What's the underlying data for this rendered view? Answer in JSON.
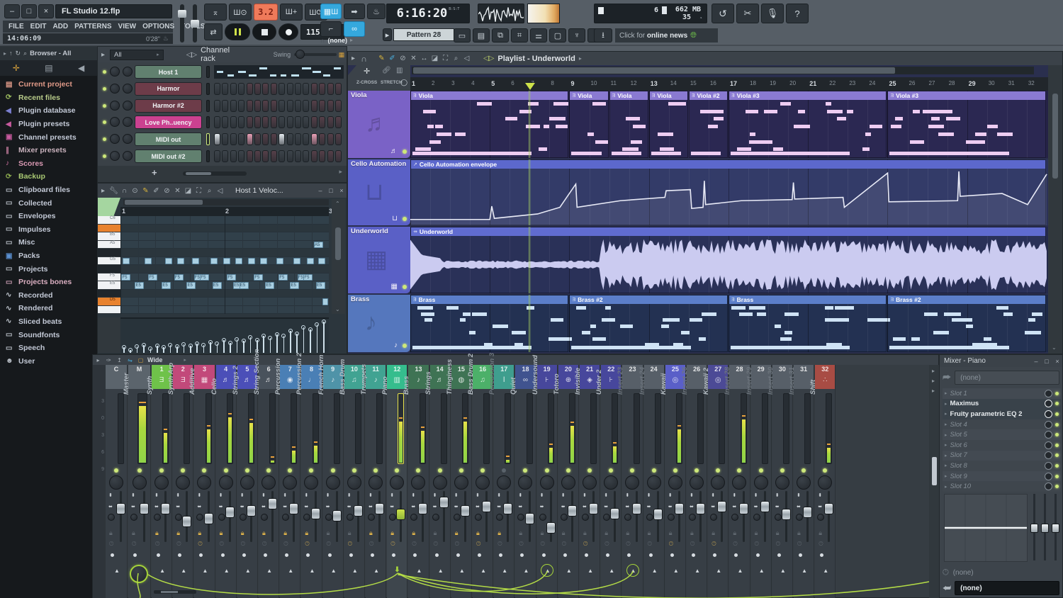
{
  "titlebar": {
    "title": "FL Studio 12.flp",
    "clock": "14:06:09",
    "song_length": "0'28\"",
    "minimize": "–",
    "maximize": "□",
    "close": "×"
  },
  "menu": {
    "items": [
      "FILE",
      "EDIT",
      "ADD",
      "PATTERNS",
      "VIEW",
      "OPTIONS",
      "TOOLS",
      "?"
    ]
  },
  "transport": {
    "bar_beat": "3.2",
    "tempo": "115.000",
    "time": "6:16:20",
    "time_unit": "B:S:T",
    "pattern": "Pattern 28",
    "pattern_plus": "+",
    "typing_target": "(none)",
    "cpu_threads": "6",
    "memory": "662 MB",
    "cpu": "35",
    "news": "Click for ",
    "news_bold": "online news"
  },
  "browser": {
    "header": "Browser - All",
    "items": [
      {
        "label": "Current project",
        "color": "#e09a88",
        "ic": "▤",
        "icc": "#e09a88"
      },
      {
        "label": "Recent files",
        "color": "#b9cc8a",
        "ic": "⟳",
        "icc": "#9fc060"
      },
      {
        "label": "Plugin database",
        "color": "#c3c9d6",
        "ic": "◀",
        "icc": "#7a7fd0"
      },
      {
        "label": "Plugin presets",
        "color": "#c3c9d6",
        "ic": "◀",
        "icc": "#c75a9e"
      },
      {
        "label": "Channel presets",
        "color": "#c3c9d6",
        "ic": "▣",
        "icc": "#c75a9e"
      },
      {
        "label": "Mixer presets",
        "color": "#c9b2bd",
        "ic": "∥",
        "icc": "#c07a9a"
      },
      {
        "label": "Scores",
        "color": "#d999b3",
        "ic": "♪",
        "icc": "#d070a0"
      },
      {
        "label": "Backup",
        "color": "#a9c973",
        "ic": "⟳",
        "icc": "#8fb050"
      },
      {
        "label": "Clipboard files",
        "color": "#c3c9d6",
        "ic": "▭",
        "icc": "#b8bec6"
      },
      {
        "label": "Collected",
        "color": "#c3c9d6",
        "ic": "▭",
        "icc": "#b8bec6"
      },
      {
        "label": "Envelopes",
        "color": "#c3c9d6",
        "ic": "▭",
        "icc": "#b8bec6"
      },
      {
        "label": "Impulses",
        "color": "#c3c9d6",
        "ic": "▭",
        "icc": "#b8bec6"
      },
      {
        "label": "Misc",
        "color": "#c3c9d6",
        "ic": "▭",
        "icc": "#b8bec6"
      },
      {
        "label": "Packs",
        "color": "#c3c9d6",
        "ic": "▣",
        "icc": "#5a8fd0"
      },
      {
        "label": "Projects",
        "color": "#c3c9d6",
        "ic": "▭",
        "icc": "#b8bec6"
      },
      {
        "label": "Projects bones",
        "color": "#d9aec0",
        "ic": "▭",
        "icc": "#c79ab0"
      },
      {
        "label": "Recorded",
        "color": "#c3c9d6",
        "ic": "∿",
        "icc": "#b8bec6"
      },
      {
        "label": "Rendered",
        "color": "#c3c9d6",
        "ic": "∿",
        "icc": "#b8bec6"
      },
      {
        "label": "Sliced beats",
        "color": "#c3c9d6",
        "ic": "∿",
        "icc": "#b8bec6"
      },
      {
        "label": "Soundfonts",
        "color": "#c3c9d6",
        "ic": "▭",
        "icc": "#b8bec6"
      },
      {
        "label": "Speech",
        "color": "#c3c9d6",
        "ic": "▭",
        "icc": "#b8bec6"
      },
      {
        "label": "User",
        "color": "#c3c9d6",
        "ic": "☻",
        "icc": "#b8bec6"
      }
    ]
  },
  "channel_rack": {
    "title": "Channel rack",
    "filter": "All",
    "swing": "Swing",
    "add": "+",
    "channels": [
      {
        "name": "Host 1",
        "color": "#61806f",
        "kind": "preview",
        "lit": []
      },
      {
        "name": "Harmor",
        "color": "#6d3c49",
        "kind": "steps",
        "lit": []
      },
      {
        "name": "Harmor #2",
        "color": "#6d3c49",
        "kind": "steps",
        "lit": []
      },
      {
        "name": "Love Ph..uency",
        "color": "#cb4190",
        "kind": "steps",
        "lit": []
      },
      {
        "name": "MIDI out",
        "color": "#61806f",
        "kind": "steps",
        "lit": [
          {
            "i": 0,
            "c": "#e3e9ee"
          },
          {
            "i": 4,
            "c": "#e79fb5"
          },
          {
            "i": 8,
            "c": "#e3e9ee"
          },
          {
            "i": 12,
            "c": "#e79fb5"
          }
        ]
      },
      {
        "name": "MIDI out #2",
        "color": "#61806f",
        "kind": "steps",
        "lit": []
      }
    ]
  },
  "piano_roll": {
    "title": "Host 1 Veloc...",
    "bars": [
      "1",
      "2",
      "3"
    ],
    "keys": [
      "C6",
      "B5",
      "A5",
      "G5",
      "F5",
      "E5",
      "D5"
    ],
    "g5": [
      0.01,
      0.115,
      0.215,
      0.275,
      0.345,
      0.435,
      0.495,
      0.555,
      0.615,
      0.675,
      0.755,
      0.835,
      0.9,
      0.955
    ],
    "f5": [
      0.005,
      0.135,
      0.26,
      0.355,
      0.385,
      0.515,
      0.645,
      0.765,
      0.855,
      0.885
    ],
    "e5": [
      0.07,
      0.2,
      0.32,
      0.445,
      0.545,
      0.575,
      0.7,
      0.82,
      0.945
    ],
    "a5": [
      0.935
    ],
    "d5": [
      0.975
    ],
    "velocities": [
      0.18,
      0.1,
      0.2,
      0.24,
      0.14,
      0.22,
      0.18,
      0.26,
      0.2,
      0.28,
      0.22,
      0.3,
      0.25,
      0.34,
      0.3,
      0.4,
      0.32,
      0.44,
      0.38,
      0.5,
      0.42,
      0.55,
      0.48,
      0.6,
      0.55,
      0.7,
      0.62,
      0.82,
      0.74,
      0.92,
      1.0
    ]
  },
  "playlist": {
    "title": "Playlist - Underworld",
    "zcross": "Z-CROSS",
    "stretch": "STRETCH",
    "playhead_bar": 7,
    "tracks": [
      {
        "name": "Viola",
        "color": "#7a62c6",
        "bg": "#2b2852",
        "bar": "#8a7ad2",
        "note": "#eecdf2",
        "icon": "violin-icon",
        "glyph": "♬",
        "clips": [
          {
            "label": "Viola",
            "start": 1,
            "len": 8
          },
          {
            "label": "Viola",
            "start": 9,
            "len": 2
          },
          {
            "label": "Viola",
            "start": 11,
            "len": 2
          },
          {
            "label": "Viola",
            "start": 13,
            "len": 2
          },
          {
            "label": "Viola #2",
            "start": 15,
            "len": 2
          },
          {
            "label": "Viola #3",
            "start": 17,
            "len": 8
          },
          {
            "label": "Viola #3",
            "start": 25,
            "len": 8
          }
        ]
      },
      {
        "name": "Cello Automation",
        "color": "#5a60c6",
        "bg": "#333b68",
        "bar": "#5c68cc",
        "note": "#f0f0fa",
        "icon": "plug-icon",
        "glyph": "⊔",
        "clips": [
          {
            "label": "Cello Automation envelope",
            "start": 1,
            "len": 32,
            "type": "automation"
          }
        ],
        "curve": [
          [
            0,
            0.08
          ],
          [
            0.125,
            0.08
          ],
          [
            0.128,
            0.32
          ],
          [
            0.132,
            0.1
          ],
          [
            0.2,
            0.18
          ],
          [
            0.235,
            0.3
          ],
          [
            0.26,
            0.72
          ],
          [
            0.262,
            0.3
          ],
          [
            0.33,
            0.42
          ],
          [
            0.4,
            0.48
          ],
          [
            0.402,
            0.6
          ],
          [
            0.44,
            0.62
          ],
          [
            0.442,
            0.28
          ],
          [
            0.46,
            0.3
          ],
          [
            0.462,
            0.78
          ],
          [
            0.464,
            0.35
          ],
          [
            0.52,
            0.42
          ],
          [
            0.6,
            0.44
          ],
          [
            0.602,
            0.75
          ],
          [
            0.604,
            0.45
          ],
          [
            0.68,
            0.48
          ],
          [
            0.682,
            0.3
          ],
          [
            0.75,
            0.92
          ],
          [
            0.752,
            0.4
          ],
          [
            0.86,
            0.42
          ],
          [
            0.862,
            0.95
          ],
          [
            0.864,
            0.5
          ],
          [
            0.93,
            0.55
          ],
          [
            0.97,
            0.35
          ],
          [
            1.0,
            0.9
          ]
        ]
      },
      {
        "name": "Underworld",
        "color": "#5a60c6",
        "bg": "#2a3158",
        "bar": "#606cd0",
        "note": "#cbcbf0",
        "icon": "sampler-icon",
        "glyph": "▦",
        "clips": [
          {
            "label": "Underworld",
            "start": 1,
            "len": 32,
            "type": "audio"
          }
        ]
      },
      {
        "name": "Brass",
        "color": "#5577bd",
        "bg": "#233152",
        "bar": "#5b7ec9",
        "note": "#cfe3f5",
        "icon": "trumpet-icon",
        "glyph": "♪",
        "clips": [
          {
            "label": "Brass",
            "start": 1,
            "len": 8
          },
          {
            "label": "Brass #2",
            "start": 9,
            "len": 8
          },
          {
            "label": "Brass",
            "start": 17,
            "len": 8
          },
          {
            "label": "Brass #2",
            "start": 25,
            "len": 8
          }
        ]
      }
    ]
  },
  "mixer": {
    "view": "Wide",
    "current_label": "C",
    "master_label": "M",
    "master_name": "Master",
    "channels": [
      {
        "num": "1",
        "name": "Synth",
        "color": "#6fc24a",
        "meter": 0.45,
        "fader": 0.3,
        "lock": true
      },
      {
        "num": "2",
        "name": "Synth Arp",
        "color": "#c2497a",
        "meter": 0,
        "fader": 0.62,
        "lock": true
      },
      {
        "num": "3",
        "name": "Additive",
        "color": "#c2497a",
        "meter": 0.5,
        "fader": 0.55,
        "lock": true
      },
      {
        "num": "4",
        "name": "Cello",
        "color": "#4b4fb8",
        "meter": 0.68,
        "fader": 0.4,
        "lock": true
      },
      {
        "num": "5",
        "name": "Strings 2",
        "color": "#4b4fb8",
        "meter": 0.6,
        "fader": 0.35,
        "lock": true
      },
      {
        "num": "6",
        "name": "String Section",
        "color": "#49525c",
        "meter": 0.03,
        "fader": 0.18,
        "lock": true
      },
      {
        "num": "7",
        "name": "Percussion",
        "color": "#4a7fb5",
        "meter": 0.18,
        "fader": 0.3,
        "lock": true
      },
      {
        "num": "8",
        "name": "Percussion 2",
        "color": "#4a7fb5",
        "meter": 0.26,
        "fader": 0.42,
        "lock": true
      },
      {
        "num": "9",
        "name": "French Horn",
        "color": "#4f93a8",
        "meter": 0,
        "fader": 0.48,
        "lock": false
      },
      {
        "num": "10",
        "name": "Bass Drum",
        "color": "#41a392",
        "meter": 0,
        "fader": 0.35,
        "lock": false
      },
      {
        "num": "11",
        "name": "Trumpets",
        "color": "#41a392",
        "meter": 0,
        "fader": 0.3,
        "lock": true
      },
      {
        "num": "12",
        "name": "Piano",
        "color": "#35bd8d",
        "meter": 0.62,
        "fader": 0.45,
        "lock": true,
        "selected": true
      },
      {
        "num": "13",
        "name": "Brass",
        "color": "#3f7354",
        "meter": 0.48,
        "fader": 0.3,
        "lock": true
      },
      {
        "num": "14",
        "name": "Strings",
        "color": "#3f7354",
        "meter": 0,
        "fader": 0.15,
        "lock": false
      },
      {
        "num": "15",
        "name": "Thinginess",
        "color": "#3f7354",
        "meter": 0.62,
        "fader": 0.35,
        "lock": true
      },
      {
        "num": "16",
        "name": "Bass Drum 2",
        "color": "#4cb069",
        "meter": 0,
        "fader": 0.25,
        "lock": true
      },
      {
        "num": "17",
        "name": "Percussion 3",
        "color": "#3f9e8e",
        "meter": 0.04,
        "fader": 0.3,
        "lock": true,
        "dim": true
      },
      {
        "num": "18",
        "name": "Quiet",
        "color": "#40538f",
        "meter": 0,
        "fader": 0.55,
        "lock": false
      },
      {
        "num": "19",
        "name": "Undersound",
        "color": "#47479c",
        "meter": 0.22,
        "fader": 0.78,
        "lock": false,
        "send": true
      },
      {
        "num": "20",
        "name": "Totoro",
        "color": "#47479c",
        "meter": 0.55,
        "fader": 0.35,
        "lock": false
      },
      {
        "num": "21",
        "name": "Invisible",
        "color": "#47479c",
        "meter": 0,
        "fader": 0.3,
        "lock": false
      },
      {
        "num": "22",
        "name": "Under 2",
        "color": "#47479c",
        "meter": 0.25,
        "fader": 0.42,
        "lock": false
      },
      {
        "num": "23",
        "name": "Insert 23",
        "color": "#575f68",
        "meter": 0,
        "fader": 0.3,
        "lock": false,
        "dim": true,
        "send": true
      },
      {
        "num": "24",
        "name": "Insert 24",
        "color": "#575f68",
        "meter": 0,
        "fader": 0.45,
        "lock": false,
        "dim": true
      },
      {
        "num": "25",
        "name": "Kawaii",
        "color": "#5a5fc8",
        "meter": 0.5,
        "fader": 0.3,
        "lock": false
      },
      {
        "num": "26",
        "name": "Insert 26",
        "color": "#575f68",
        "meter": 0,
        "fader": 0.3,
        "lock": false,
        "dim": true
      },
      {
        "num": "27",
        "name": "Kawaii 2",
        "color": "#4c4a96",
        "meter": 0,
        "fader": 0.25,
        "lock": false
      },
      {
        "num": "28",
        "name": "Insert 28",
        "color": "#575f68",
        "meter": 0.65,
        "fader": 0.3,
        "lock": false,
        "dim": true
      },
      {
        "num": "29",
        "name": "Insert 29",
        "color": "#575f68",
        "meter": 0,
        "fader": 0.25,
        "lock": false,
        "dim": true
      },
      {
        "num": "30",
        "name": "Insert 30",
        "color": "#575f68",
        "meter": 0,
        "fader": 0.45,
        "lock": false,
        "dim": true
      },
      {
        "num": "31",
        "name": "Insert 31",
        "color": "#575f68",
        "meter": 0,
        "fader": 0.4,
        "lock": false,
        "dim": true
      },
      {
        "num": "32",
        "name": "Shift",
        "color": "#a84c44",
        "meter": 0.22,
        "fader": 0.3,
        "lock": false
      }
    ],
    "icons": {
      "1": "Ǝ",
      "2": "Ǝ",
      "3": "▦",
      "4": "♬",
      "5": "♬",
      "6": "♬",
      "7": "◉",
      "8": "♩",
      "9": "♪",
      "10": "♫",
      "11": "♪",
      "12": "▥",
      "13": "♪",
      "14": "♬",
      "15": "◍",
      "16": "♫",
      "17": "Ⅰ",
      "18": "∞",
      "19": "⊦",
      "20": "⊕",
      "21": "◈",
      "22": "⊦",
      "25": "◎",
      "27": "◎",
      "32": "∴"
    }
  },
  "fx": {
    "title": "Mixer - Piano",
    "input": "(none)",
    "slots": [
      {
        "label": "Slot 1",
        "dim": true
      },
      {
        "label": "Maximus",
        "dim": false
      },
      {
        "label": "Fruity parametric EQ 2",
        "dim": false
      },
      {
        "label": "Slot 4",
        "dim": true
      },
      {
        "label": "Slot 5",
        "dim": true
      },
      {
        "label": "Slot 6",
        "dim": true
      },
      {
        "label": "Slot 7",
        "dim": true
      },
      {
        "label": "Slot 8",
        "dim": true
      },
      {
        "label": "Slot 9",
        "dim": true
      },
      {
        "label": "Slot 10",
        "dim": true
      }
    ],
    "time": "(none)",
    "output": "(none)"
  }
}
